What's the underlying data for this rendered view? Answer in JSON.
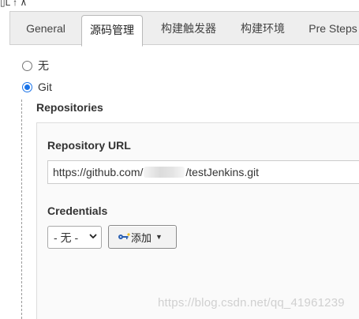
{
  "header": {
    "cut_text": "▯L ↑ ∧"
  },
  "tabs": [
    {
      "label": "General",
      "active": false
    },
    {
      "label": "源码管理",
      "active": true
    },
    {
      "label": "构建触发器",
      "active": false
    },
    {
      "label": "构建环境",
      "active": false
    },
    {
      "label": "Pre Steps",
      "active": false
    }
  ],
  "scm": {
    "options": [
      {
        "label": "无",
        "checked": false
      },
      {
        "label": "Git",
        "checked": true
      }
    ],
    "repositories_label": "Repositories",
    "repo_url_label": "Repository URL",
    "repo_url_prefix": "https://github.com/",
    "repo_url_suffix": "/testJenkins.git",
    "credentials_label": "Credentials",
    "credentials_selected": "- 无 -",
    "add_button_label": "添加"
  },
  "watermark": "https://blog.csdn.net/qq_41961239",
  "colors": {
    "accent": "#1a73e8",
    "tab_bg": "#eeeeee",
    "panel_bg": "#fafafa"
  }
}
